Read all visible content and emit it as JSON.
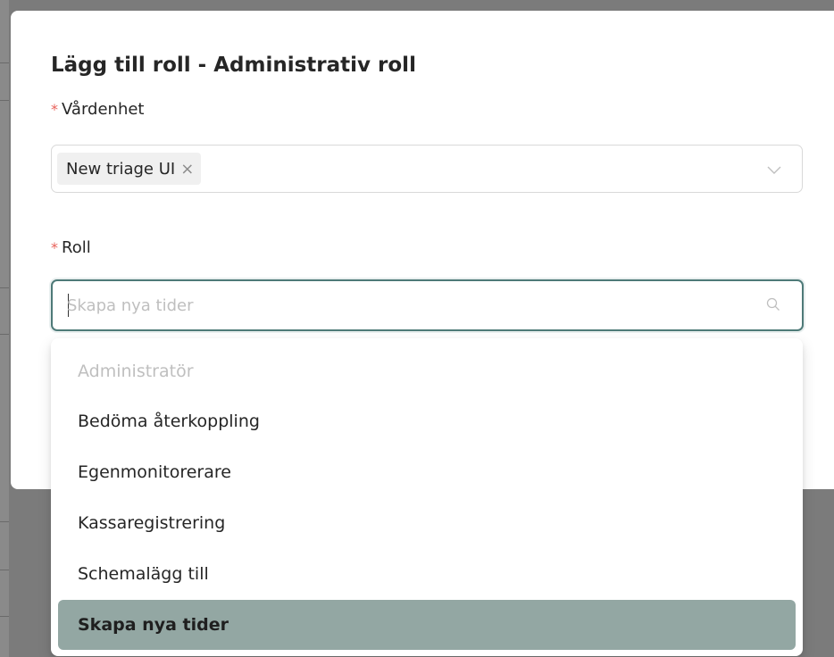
{
  "modal": {
    "title": "Lägg till roll - Administrativ roll"
  },
  "fields": {
    "unit": {
      "required_mark": "*",
      "label": "Vårdenhet",
      "selected_tag": "New triage UI",
      "tag_close": "×",
      "chevron_icon": "chevron-down-icon"
    },
    "role": {
      "required_mark": "*",
      "label": "Roll",
      "placeholder": "Skapa nya tider",
      "value": "",
      "search_icon": "search-icon"
    }
  },
  "dropdown": {
    "options": [
      {
        "label": "Administratör",
        "state": "disabled"
      },
      {
        "label": "Bedöma återkoppling",
        "state": "normal"
      },
      {
        "label": "Egenmonitorerare",
        "state": "normal"
      },
      {
        "label": "Kassaregistrering",
        "state": "normal"
      },
      {
        "label": "Schemalägg till",
        "state": "normal"
      },
      {
        "label": "Skapa nya tider",
        "state": "selected"
      }
    ]
  },
  "colors": {
    "accent_border": "#4e7a78",
    "selected_option_bg": "#93a7a3",
    "required_mark": "#e8615a",
    "backdrop": "#7b7b7b"
  }
}
